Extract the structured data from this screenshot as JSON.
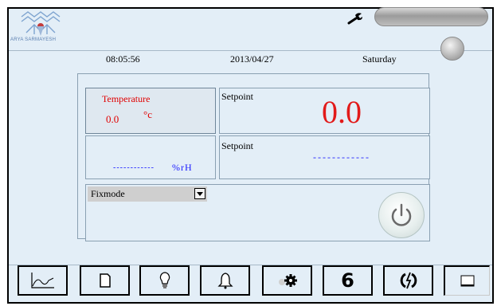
{
  "header": {
    "logo_text": "ARYA SARMAYESH",
    "icons": [
      "snowflake-logo-icon",
      "wrench-icon"
    ]
  },
  "info": {
    "time": "08:05:56",
    "date": "2013/04/27",
    "day": "Saturday"
  },
  "temperature": {
    "label": "Temperature",
    "value": "0.0",
    "unit": "°c"
  },
  "setpoint1": {
    "label": "Setpoint",
    "value": "0.0"
  },
  "humidity": {
    "value": "------------",
    "unit": "%rH"
  },
  "setpoint2": {
    "label": "Setpoint",
    "value": "------------"
  },
  "mode": {
    "selected": "Fixmode"
  },
  "toolbar": {
    "six_label": "6",
    "buttons": [
      "chart-icon",
      "document-icon",
      "bulb-icon",
      "bell-icon",
      "gear-icon",
      "six",
      "refresh-icon",
      "window-icon"
    ]
  },
  "colors": {
    "background": "#e3eef7",
    "value_red": "#e21a1a",
    "humidity_blue": "#1a1aff"
  }
}
